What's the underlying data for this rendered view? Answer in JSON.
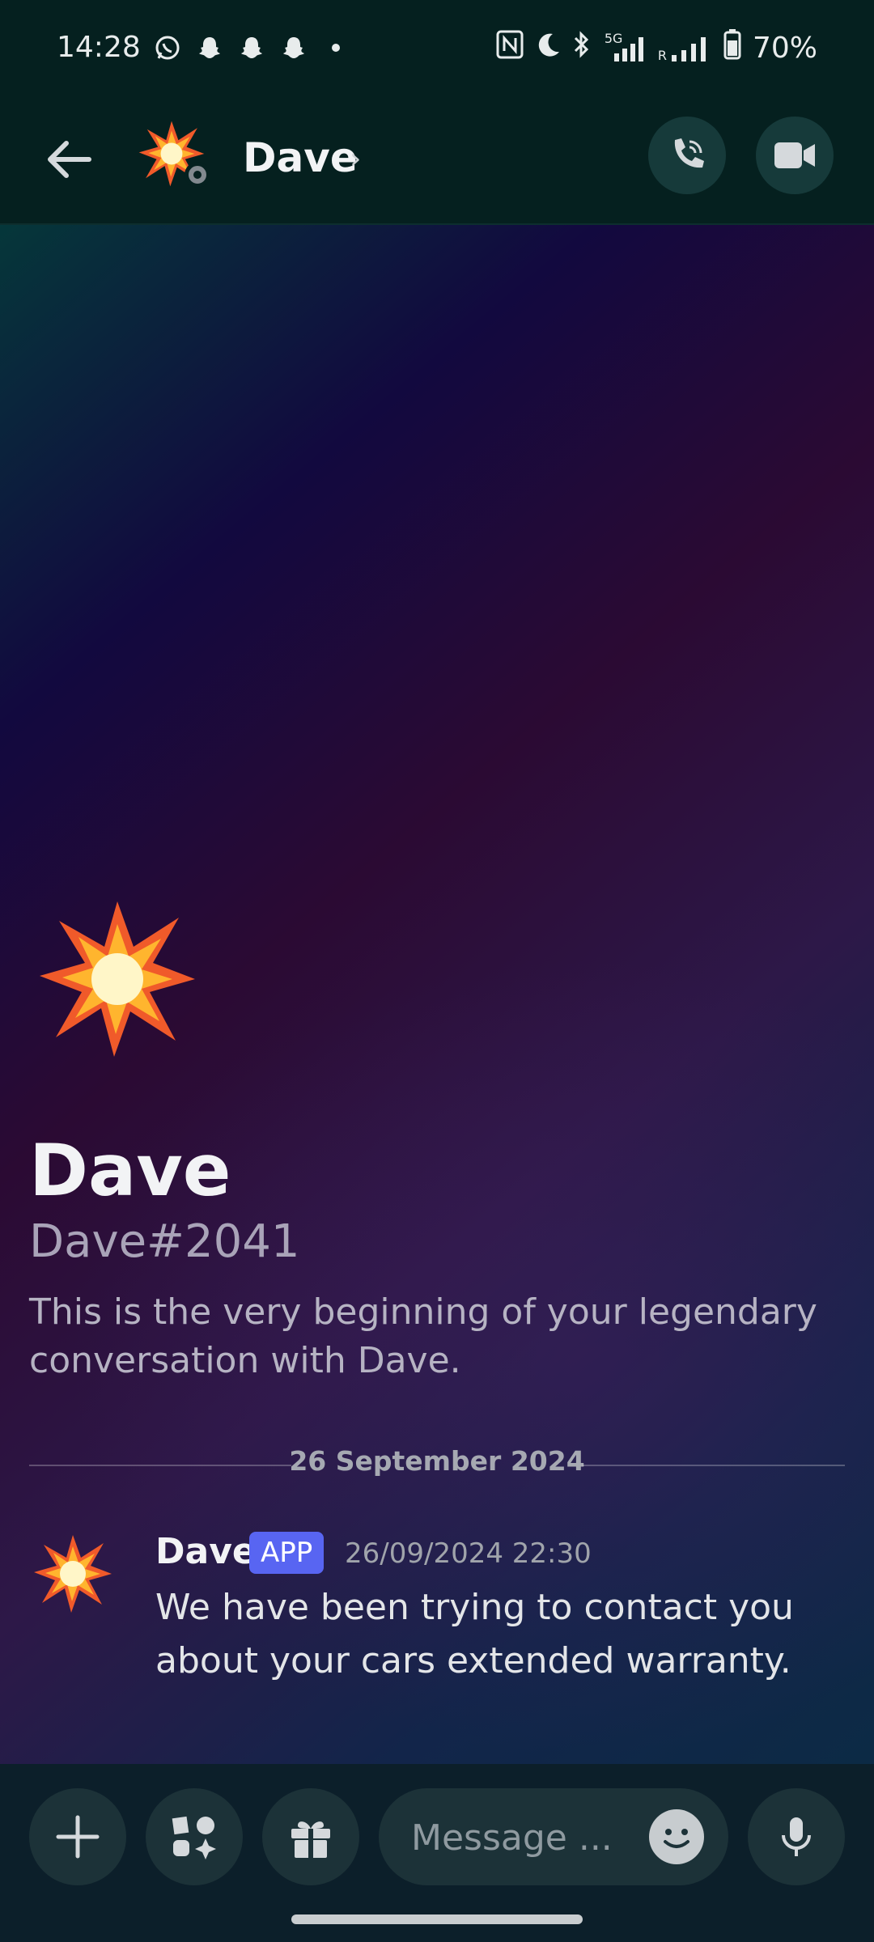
{
  "status_bar": {
    "time": "14:28",
    "battery": "70%",
    "notification_icons": [
      "whatsapp-icon",
      "snapchat-icon",
      "snapchat-icon",
      "snapchat-icon",
      "dot-icon"
    ],
    "system_icons": [
      "nfc-icon",
      "moon-icon",
      "bluetooth-icon",
      "signal-5g-icon",
      "signal-r-icon",
      "battery-icon"
    ],
    "network_label": "5G",
    "roaming_label": "R"
  },
  "header": {
    "name": "Dave",
    "chevron": "›",
    "avatar_emoji": "💥",
    "status": "offline"
  },
  "profile": {
    "avatar_emoji": "💥",
    "name": "Dave",
    "tag": "Dave#2041",
    "intro": "This is the very beginning of your legendary conversation with Dave."
  },
  "divider": {
    "date": "26 September 2024"
  },
  "messages": [
    {
      "avatar_emoji": "💥",
      "author": "Dave",
      "badge": "APP",
      "timestamp": "26/09/2024 22:30",
      "text": "We have been trying to contact you about your cars extended warranty."
    }
  ],
  "input": {
    "placeholder": "Message ..."
  },
  "colors": {
    "header_bg": "#05201f",
    "badge_bg": "#5865f2",
    "input_bg": "#1c3238"
  }
}
